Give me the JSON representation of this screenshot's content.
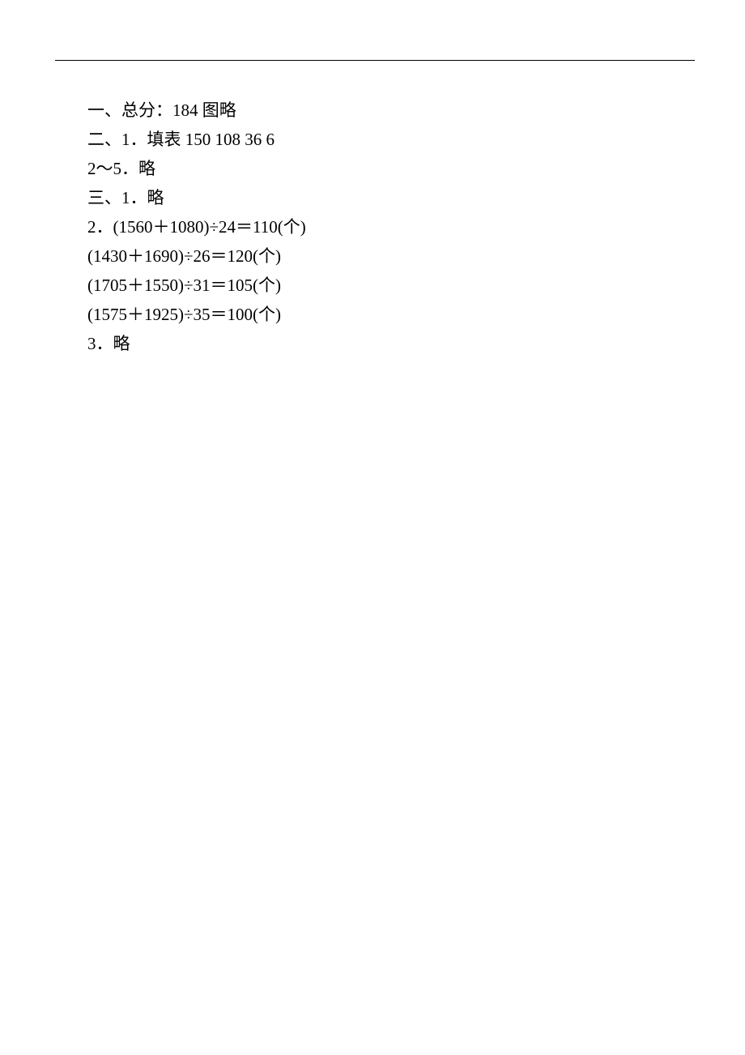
{
  "lines": [
    "一、总分：184 图略",
    "二、1．填表 150 108 36 6",
    "2～5．略",
    "三、1．略",
    "2．(1560＋1080)÷24＝110(个)",
    "(1430＋1690)÷26＝120(个)",
    "(1705＋1550)÷31＝105(个)",
    "(1575＋1925)÷35＝100(个)",
    "3．略"
  ]
}
